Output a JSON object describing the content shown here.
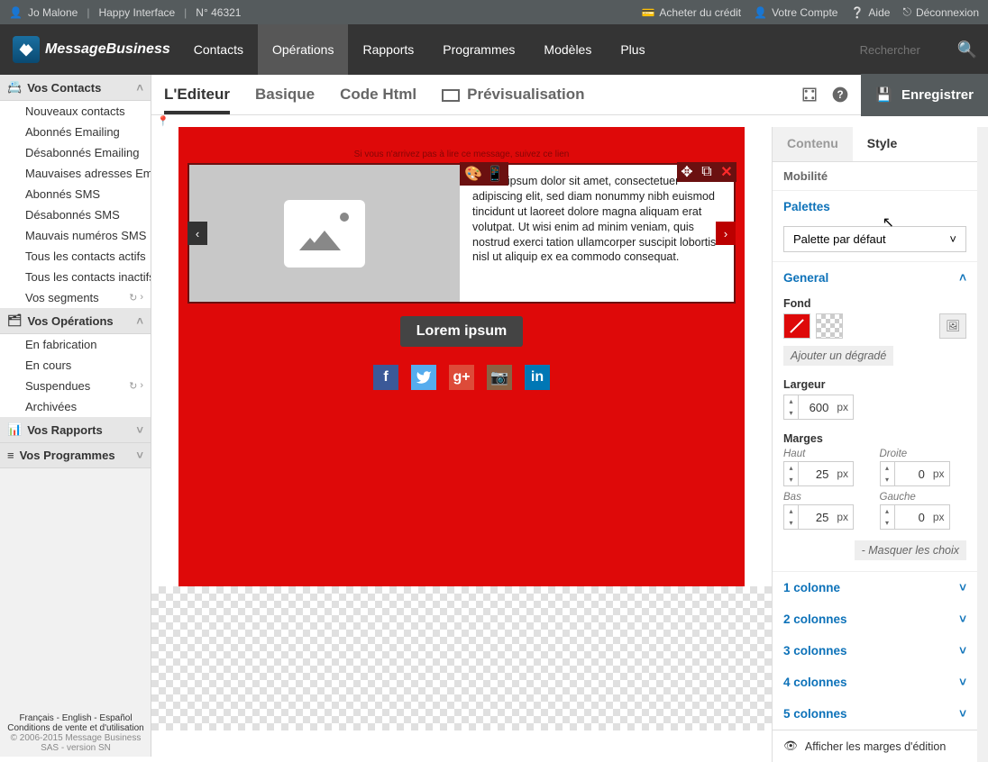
{
  "topbar": {
    "user": "Jo Malone",
    "interface": "Happy Interface",
    "account_no": "N° 46321",
    "buy_credit": "Acheter du crédit",
    "your_account": "Votre Compte",
    "help": "Aide",
    "logout": "Déconnexion"
  },
  "logo": "MessageBusiness",
  "nav": {
    "contacts": "Contacts",
    "operations": "Opérations",
    "reports": "Rapports",
    "programs": "Programmes",
    "templates": "Modèles",
    "more": "Plus"
  },
  "search_placeholder": "Rechercher",
  "sidebar": {
    "contacts_header": "Vos Contacts",
    "contacts": [
      "Nouveaux contacts",
      "Abonnés Emailing",
      "Désabonnés Emailing",
      "Mauvaises adresses Emailing",
      "Abonnés SMS",
      "Désabonnés SMS",
      "Mauvais numéros SMS",
      "Tous les contacts actifs",
      "Tous les contacts inactifs",
      "Vos segments"
    ],
    "ops_header": "Vos Opérations",
    "ops": [
      "En fabrication",
      "En cours",
      "Suspendues",
      "Archivées"
    ],
    "reports_header": "Vos Rapports",
    "programs_header": "Vos Programmes"
  },
  "footer": {
    "fr": "Français",
    "en": "English",
    "es": "Español",
    "terms": "Conditions de vente et d'utilisation",
    "copyright": "© 2006-2015 Message Business SAS - version SN"
  },
  "subnav": {
    "editor": "L'Editeur",
    "basic": "Basique",
    "html": "Code Html",
    "preview": "Prévisualisation",
    "save": "Enregistrer"
  },
  "canvas": {
    "info_line": "Si vous n'arrivez pas à lire ce message, suivez ce lien",
    "lorem": "Lorem ipsum dolor sit amet, consectetuer adipiscing elit, sed diam nonummy nibh euismod tincidunt ut laoreet dolore magna aliquam erat volutpat. Ut wisi enim ad minim veniam, quis nostrud exerci tation ullamcorper suscipit lobortis nisl ut aliquip ex ea commodo consequat.",
    "cta": "Lorem ipsum"
  },
  "panel": {
    "tab_content": "Contenu",
    "tab_style": "Style",
    "mobility": "Mobilité",
    "palettes": "Palettes",
    "palette_default": "Palette par défaut",
    "general": "General",
    "fond": "Fond",
    "add_gradient": "Ajouter un dégradé",
    "largeur": "Largeur",
    "largeur_val": "600",
    "marges": "Marges",
    "haut": "Haut",
    "droite": "Droite",
    "bas": "Bas",
    "gauche": "Gauche",
    "haut_val": "25",
    "droite_val": "0",
    "bas_val": "25",
    "gauche_val": "0",
    "unit": "px",
    "hide": "- Masquer les choix",
    "col1": "1 colonne",
    "col2": "2 colonnes",
    "col3": "3 colonnes",
    "col4": "4 colonnes",
    "col5": "5 colonnes",
    "show_margins": "Afficher les marges d'édition"
  }
}
